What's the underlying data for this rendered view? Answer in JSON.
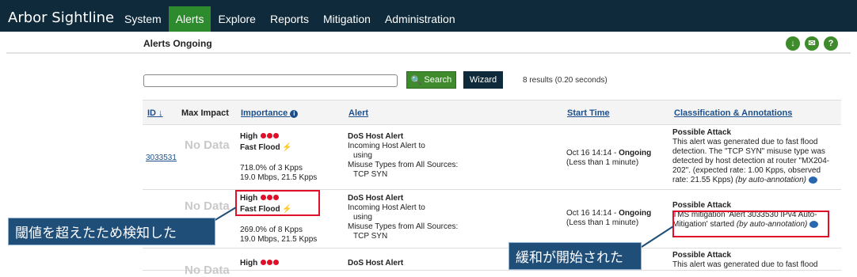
{
  "header": {
    "brand": "Arbor Sightline",
    "nav": [
      "System",
      "Alerts",
      "Explore",
      "Reports",
      "Mitigation",
      "Administration"
    ],
    "active_nav": "Alerts"
  },
  "subheader": {
    "title": "Alerts Ongoing",
    "icons": [
      "download-icon",
      "email-icon",
      "help-icon"
    ]
  },
  "search": {
    "value": "",
    "search_label": "Search",
    "wizard_label": "Wizard",
    "results_text": "8 results (0.20 seconds)"
  },
  "table": {
    "columns": {
      "id": "ID",
      "max_impact": "Max Impact",
      "importance": "Importance",
      "alert": "Alert",
      "start_time": "Start Time",
      "classification": "Classification & Annotations"
    },
    "rows": [
      {
        "id": "3033531",
        "max_impact": "No Data",
        "importance": "High",
        "importance_type": "Fast Flood",
        "stats1": "718.0% of 3 Kpps",
        "stats2": "19.0 Mbps, 21.5 Kpps",
        "alert_title": "DoS Host Alert",
        "alert_line1": "Incoming Host Alert to",
        "alert_line2": "using",
        "alert_line3": "Misuse Types from All Sources:",
        "alert_line4": "TCP SYN",
        "start_time": "Oct 16 14:14 - ",
        "start_status": "Ongoing",
        "start_suffix": " (Less than 1 minute)",
        "class_title": "Possible Attack",
        "class_text": "This alert was generated due to fast flood detection. The \"TCP SYN\" misuse type was detected by host detection at router \"MX204-202\". (expected rate: 1.00 Kpps, observed rate: 21.55 Kpps)",
        "class_note": "(by auto-annotation)"
      },
      {
        "id": "",
        "max_impact": "No Data",
        "importance": "High",
        "importance_type": "Fast Flood",
        "stats1": "269.0% of 8 Kpps",
        "stats2": "19.0 Mbps, 21.5 Kpps",
        "alert_title": "DoS Host Alert",
        "alert_line1": "Incoming Host Alert to",
        "alert_line2": "using",
        "alert_line3": "Misuse Types from All Sources:",
        "alert_line4": "TCP SYN",
        "start_time": "Oct 16 14:14 - ",
        "start_status": "Ongoing",
        "start_suffix": " (Less than 1 minute)",
        "class_title": "Possible Attack",
        "class_text": "TMS mitigation 'Alert 3033530 IPv4 Auto-Mitigation' started",
        "class_note": "(by auto-annotation)"
      },
      {
        "id": "",
        "max_impact": "No Data",
        "importance": "High",
        "alert_title": "DoS Host Alert",
        "class_title": "Possible Attack",
        "class_text": "This alert was generated due to fast flood"
      }
    ]
  },
  "callouts": {
    "threshold": "閾値を超えたため検知した",
    "mitigation": "緩和が開始された"
  },
  "colors": {
    "topbar": "#0f2a3b",
    "active_nav": "#2d8a2d",
    "high_dot": "#e0102a",
    "callout": "#1f4e79"
  }
}
